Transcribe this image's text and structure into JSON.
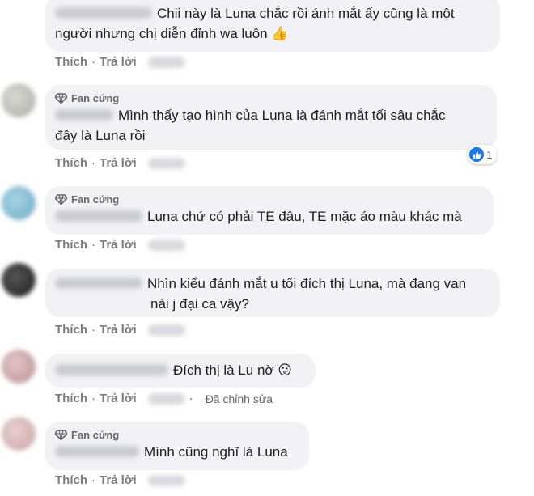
{
  "comments": [
    {
      "badge": "",
      "lines": [
        "Chii này là Luna chắc rồi ánh mắt ấy cũng là một",
        "người nhưng chị diễn đỉnh wa luôn 👍"
      ],
      "like": "Thích",
      "reply": "Trả lời",
      "edited": "",
      "reaction_count": ""
    },
    {
      "badge": "Fan cứng",
      "lines": [
        "Mình thấy tạo hình của Luna là đánh mắt tối sâu chắc",
        "đây là Luna rồi"
      ],
      "like": "Thích",
      "reply": "Trả lời",
      "edited": "",
      "reaction_count": "1"
    },
    {
      "badge": "Fan cứng",
      "lines": [
        "Luna chứ có phải TE đâu, TE mặc áo màu khác mà"
      ],
      "like": "Thích",
      "reply": "Trả lời",
      "edited": "",
      "reaction_count": ""
    },
    {
      "badge": "",
      "lines": [
        "Nhìn kiểu đánh mắt u tối đích thị Luna, mà đang van",
        "nài j đại ca vậy?"
      ],
      "like": "Thích",
      "reply": "Trả lời",
      "edited": "",
      "reaction_count": ""
    },
    {
      "badge": "",
      "lines": [
        "Đích thị là Lu nờ 😜"
      ],
      "like": "Thích",
      "reply": "Trả lời",
      "edited": "Đã chỉnh sửa",
      "reaction_count": ""
    },
    {
      "badge": "Fan cứng",
      "lines": [
        "Mình cũng nghĩ là Luna"
      ],
      "like": "Thích",
      "reply": "Trả lời",
      "edited": "",
      "reaction_count": ""
    }
  ],
  "icons": {
    "badge": "diamond-icon",
    "reaction": "like-thumb-icon"
  },
  "colors": {
    "bubble": "#f0f2f5",
    "like_blue": "#1877f2",
    "meta_gray": "#65676b"
  }
}
